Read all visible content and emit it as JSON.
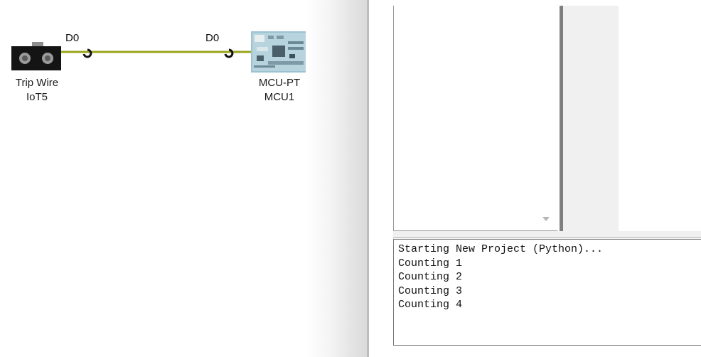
{
  "workspace": {
    "devices": [
      {
        "name": "Trip Wire",
        "id": "IoT5",
        "port": "D0",
        "icon": "trip-wire-sensor-icon"
      },
      {
        "name": "MCU-PT",
        "id": "MCU1",
        "port": "D0",
        "icon": "mcu-board-icon"
      }
    ],
    "cable_color": "#9aa51a"
  },
  "console": {
    "lines": [
      "Starting New Project (Python)...",
      "Counting 1",
      "Counting 2",
      "Counting 3",
      "Counting 4"
    ]
  }
}
